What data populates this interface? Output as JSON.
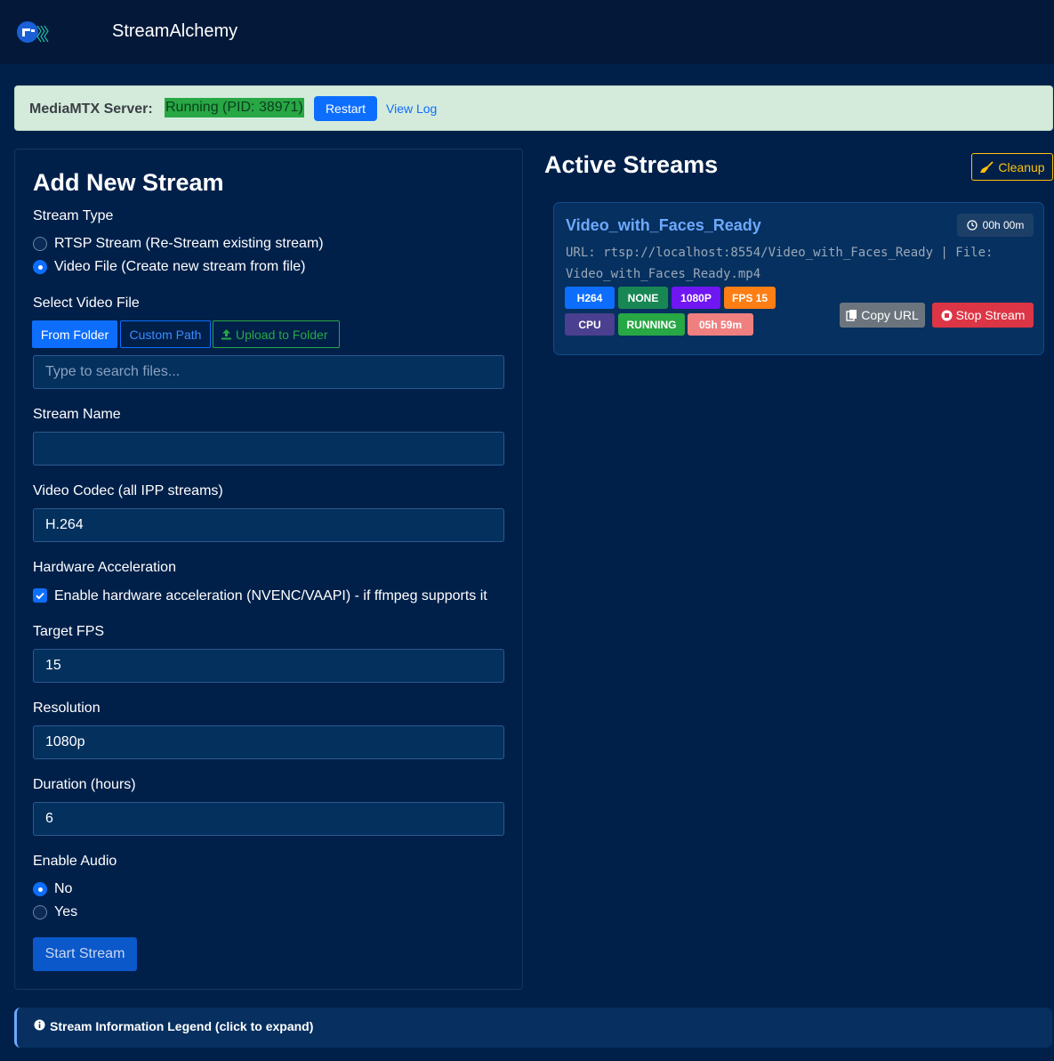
{
  "navbar": {
    "brand": "StreamAlchemy",
    "logo_icon": "streamalchemy-logo-icon"
  },
  "server_status": {
    "label": "MediaMTX Server:",
    "value": "Running (PID: 38971)",
    "restart_label": "Restart",
    "view_log_label": "View Log",
    "status_color": "#28a745"
  },
  "add_stream": {
    "title": "Add New Stream",
    "stream_type_label": "Stream Type",
    "stream_type_options": [
      {
        "label": "RTSP Stream (Re-Stream existing stream)",
        "selected": false
      },
      {
        "label": "Video File (Create new stream from file)",
        "selected": true
      }
    ],
    "select_file_label": "Select Video File",
    "source_tabs": [
      "From Folder",
      "Custom Path",
      "Upload to Folder"
    ],
    "active_source_tab": "From Folder",
    "file_search_placeholder": "Type to search files...",
    "stream_name_label": "Stream Name",
    "stream_name_value": "",
    "codec_label": "Video Codec (all IPP streams)",
    "codec_value": "H.264",
    "hw_accel_label": "Hardware Acceleration",
    "hw_accel_option": "Enable hardware acceleration (NVENC/VAAPI) - if ffmpeg supports it",
    "hw_accel_checked": true,
    "fps_label": "Target FPS",
    "fps_value": "15",
    "resolution_label": "Resolution",
    "resolution_value": "1080p",
    "duration_label": "Duration (hours)",
    "duration_value": "6",
    "audio_label": "Enable Audio",
    "audio_options": [
      {
        "label": "No",
        "selected": true
      },
      {
        "label": "Yes",
        "selected": false
      }
    ],
    "start_label": "Start Stream"
  },
  "active_streams": {
    "title": "Active Streams",
    "cleanup_label": "Cleanup",
    "streams": [
      {
        "name": "Video_with_Faces_Ready",
        "uptime": "00h 00m",
        "url_line": "URL: rtsp://localhost:8554/Video_with_Faces_Ready | File: Video_with_Faces_Ready.mp4",
        "badges": [
          {
            "text": "H264",
            "color": "#0d6efd"
          },
          {
            "text": "NONE",
            "color": "#198754"
          },
          {
            "text": "1080P",
            "color": "#6f16f3"
          },
          {
            "text": "FPS 15",
            "color": "#fd7e14"
          },
          {
            "text": "CPU",
            "color": "#4b3f8f"
          },
          {
            "text": "RUNNING",
            "color": "#28a745"
          },
          {
            "text": "05h 59m",
            "color": "#f08080"
          }
        ],
        "copy_label": "Copy URL",
        "stop_label": "Stop Stream"
      }
    ]
  },
  "legend": {
    "text": "Stream Information Legend (click to expand)"
  }
}
